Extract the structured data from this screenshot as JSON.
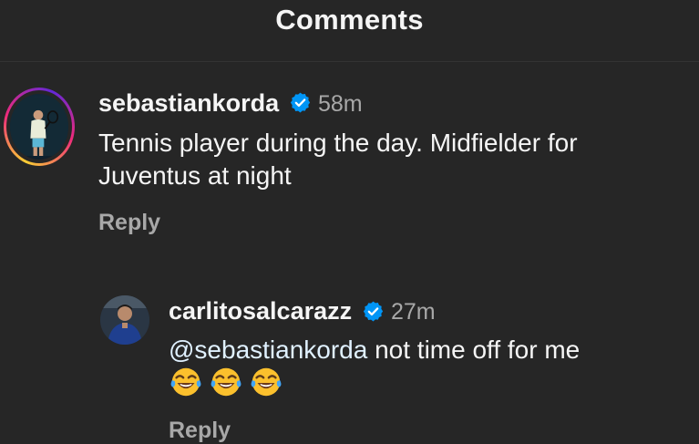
{
  "header": {
    "title": "Comments"
  },
  "comments": [
    {
      "username": "sebastiankorda",
      "verified": true,
      "time": "58m",
      "text": "Tennis player during the day. Midfielder for Juventus at night",
      "text_line1": "Tennis player during the day. Midfielder for",
      "text_line2": "Juventus at night",
      "reply_label": "Reply",
      "avatar": "avatar-with-story-ring"
    },
    {
      "username": "carlitosalcarazz",
      "verified": true,
      "time": "27m",
      "mention": "@sebastiankorda",
      "text_rest": " not time off for me",
      "emojis": [
        "😂",
        "😂",
        "😂"
      ],
      "emoji_icon": "face-with-tears-of-joy-icon",
      "reply_label": "Reply",
      "avatar": "avatar"
    }
  ],
  "colors": {
    "background": "#262626",
    "text": "#f5f5f5",
    "secondary": "#a8a8a8",
    "verified": "#0095f6",
    "mention": "#e0f1ff"
  }
}
